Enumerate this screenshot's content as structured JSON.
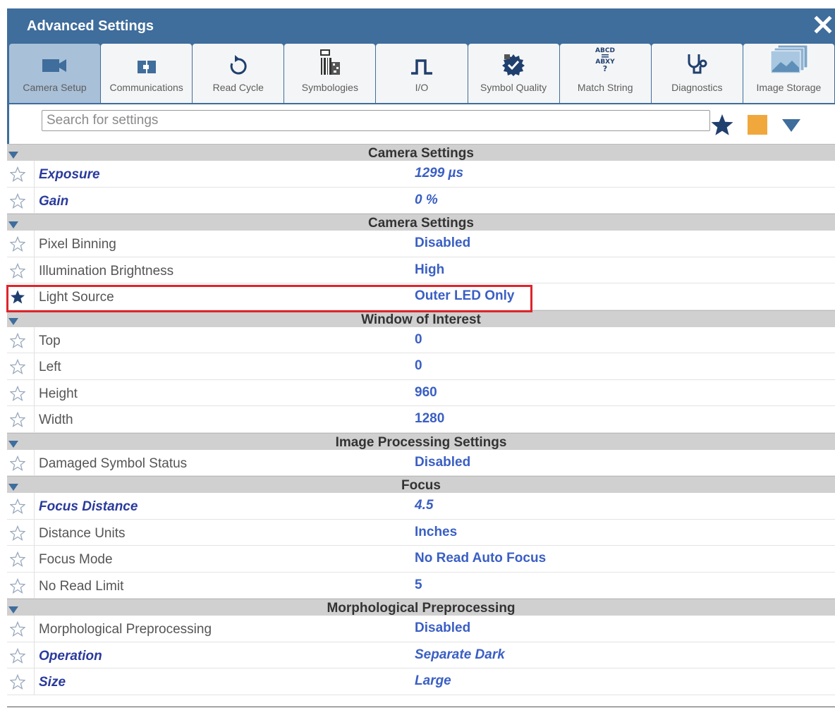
{
  "window": {
    "title": "Advanced Settings",
    "close_label": "close"
  },
  "colors": {
    "titlebar": "#3f6d9c",
    "accent_value": "#3a5fc4",
    "modified_name": "#2a3a9c",
    "highlight": "#e0242a",
    "orange": "#f0a83c"
  },
  "toolbar": [
    {
      "label": "Camera Setup",
      "icon": "camera-icon",
      "active": true
    },
    {
      "label": "Communications",
      "icon": "connector-icon",
      "active": false
    },
    {
      "label": "Read Cycle",
      "icon": "refresh-icon",
      "active": false
    },
    {
      "label": "Symbologies",
      "icon": "barcode-icon",
      "active": false
    },
    {
      "label": "I/O",
      "icon": "pulse-icon",
      "active": false
    },
    {
      "label": "Symbol Quality",
      "icon": "quality-badge-icon",
      "active": false
    },
    {
      "label": "Match String",
      "icon": "match-string-icon",
      "active": false
    },
    {
      "label": "Diagnostics",
      "icon": "stethoscope-icon",
      "active": false
    },
    {
      "label": "Image Storage",
      "icon": "image-stack-icon",
      "active": false
    }
  ],
  "search": {
    "placeholder": "Search for settings",
    "value": ""
  },
  "sections": [
    {
      "name": "Camera Settings",
      "rows": [
        {
          "name": "Exposure",
          "value": "1299 µs",
          "modified": true,
          "starred": false
        },
        {
          "name": "Gain",
          "value": "0 %",
          "modified": true,
          "starred": false
        }
      ]
    },
    {
      "name": "Camera Settings",
      "rows": [
        {
          "name": "Pixel Binning",
          "value": "Disabled",
          "modified": false,
          "starred": false
        },
        {
          "name": "Illumination Brightness",
          "value": "High",
          "modified": false,
          "starred": false
        },
        {
          "name": "Light Source",
          "value": "Outer LED Only",
          "modified": false,
          "starred": true,
          "highlighted": true
        }
      ]
    },
    {
      "name": "Window of Interest",
      "rows": [
        {
          "name": "Top",
          "value": "0",
          "modified": false,
          "starred": false
        },
        {
          "name": "Left",
          "value": "0",
          "modified": false,
          "starred": false
        },
        {
          "name": "Height",
          "value": "960",
          "modified": false,
          "starred": false
        },
        {
          "name": "Width",
          "value": "1280",
          "modified": false,
          "starred": false
        }
      ]
    },
    {
      "name": "Image Processing Settings",
      "rows": [
        {
          "name": "Damaged Symbol Status",
          "value": "Disabled",
          "modified": false,
          "starred": false
        }
      ]
    },
    {
      "name": "Focus",
      "rows": [
        {
          "name": "Focus Distance",
          "value": "4.5",
          "modified": true,
          "starred": false
        },
        {
          "name": "Distance Units",
          "value": "Inches",
          "modified": false,
          "starred": false
        },
        {
          "name": "Focus Mode",
          "value": "No Read Auto Focus",
          "modified": false,
          "starred": false
        },
        {
          "name": "No Read Limit",
          "value": "5",
          "modified": false,
          "starred": false
        }
      ]
    },
    {
      "name": "Morphological Preprocessing",
      "rows": [
        {
          "name": "Morphological Preprocessing",
          "value": "Disabled",
          "modified": false,
          "starred": false
        },
        {
          "name": "Operation",
          "value": "Separate Dark",
          "modified": true,
          "starred": false
        },
        {
          "name": "Size",
          "value": "Large",
          "modified": true,
          "starred": false
        }
      ]
    }
  ]
}
